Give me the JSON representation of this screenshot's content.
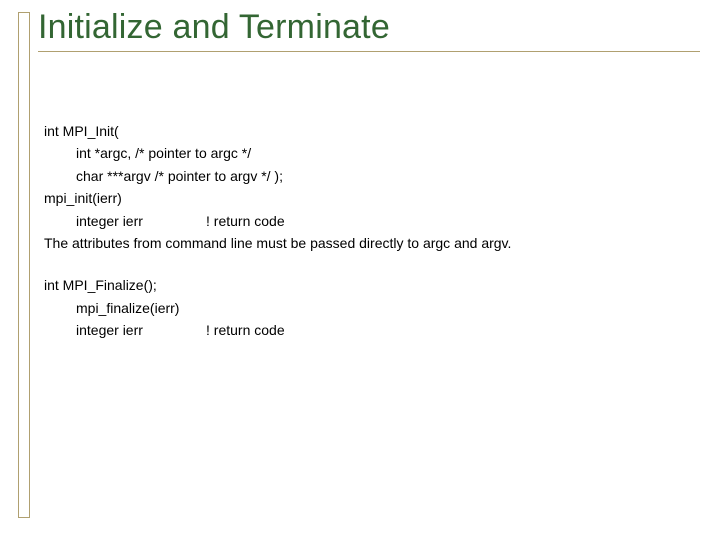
{
  "title": "Initialize and Terminate",
  "block1": {
    "l1": "int MPI_Init(",
    "l2a": "int *argc, /* pointer to argc */",
    "l3a": "char ***argv /* pointer to argv */ );",
    "l4": "mpi_init(ierr)",
    "l5a": "integer ierr",
    "l5b": "! return code",
    "l6": "The attributes from command line must be passed directly to argc and argv."
  },
  "block2": {
    "l1": "int MPI_Finalize();",
    "l2a": "mpi_finalize(ierr)",
    "l3a": "integer ierr",
    "l3b": "! return code"
  }
}
